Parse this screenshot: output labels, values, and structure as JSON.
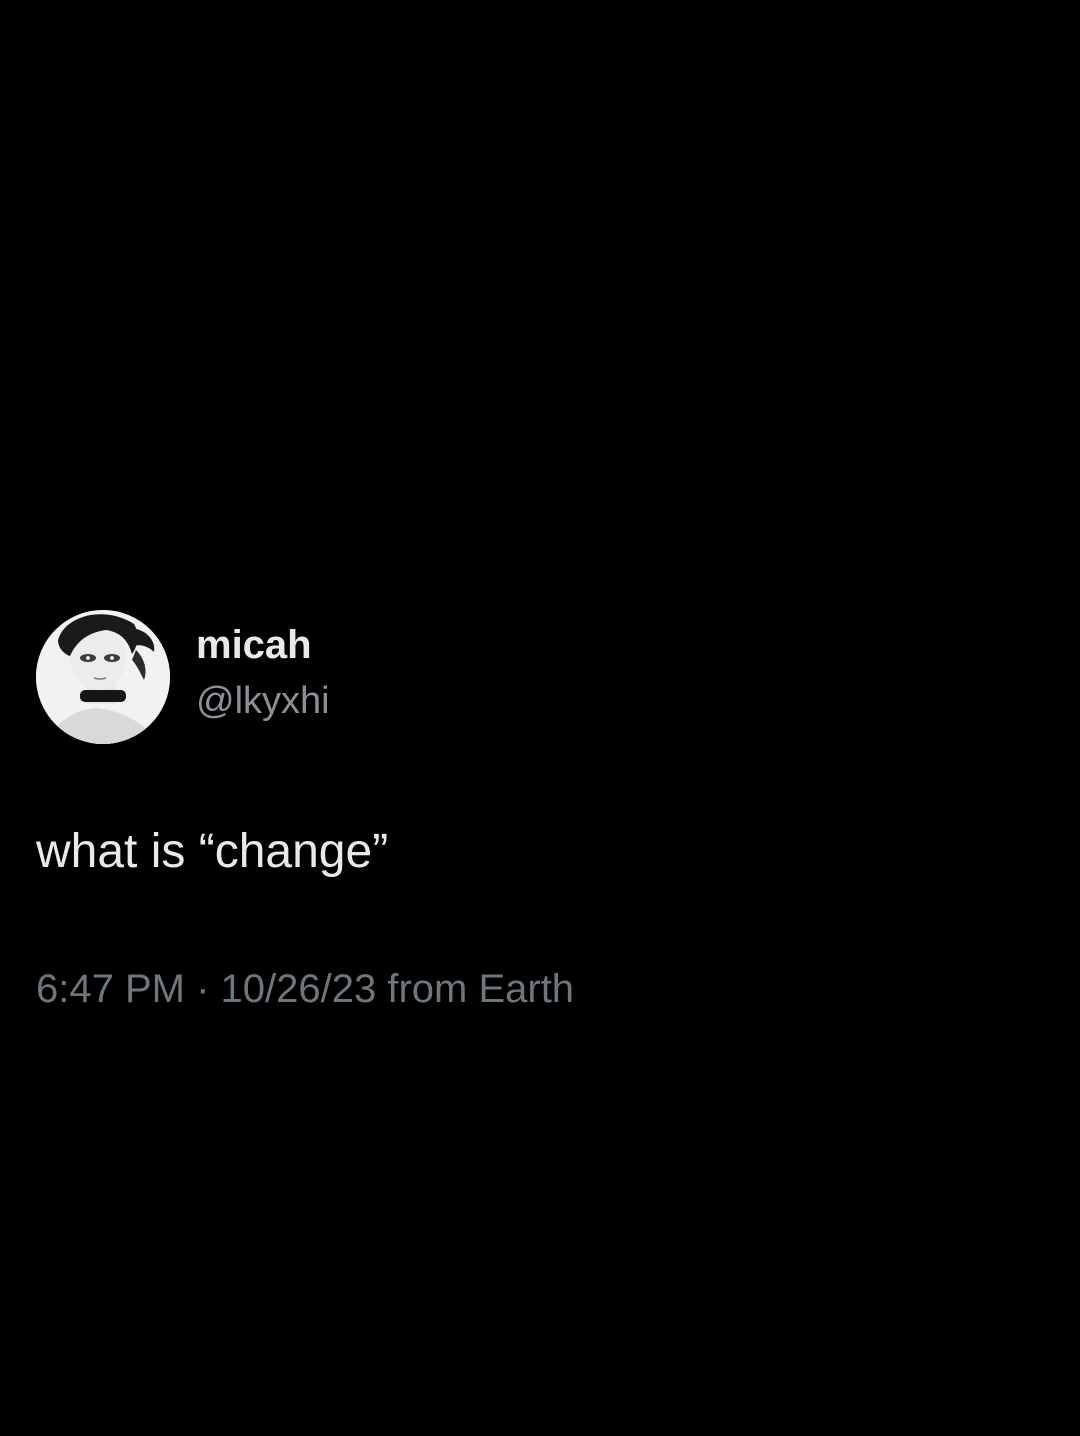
{
  "tweet": {
    "author": {
      "display_name": "micah",
      "handle": "@lkyxhi",
      "avatar_icon": "avatar-portrait"
    },
    "text": "what is “change”",
    "meta": {
      "time": "6:47 PM",
      "separator": " · ",
      "date": "10/26/23",
      "source": " from Earth"
    }
  },
  "colors": {
    "background": "#000000",
    "text_primary": "#e7e9ea",
    "text_secondary": "#8b9096",
    "text_meta": "#6e767d"
  }
}
